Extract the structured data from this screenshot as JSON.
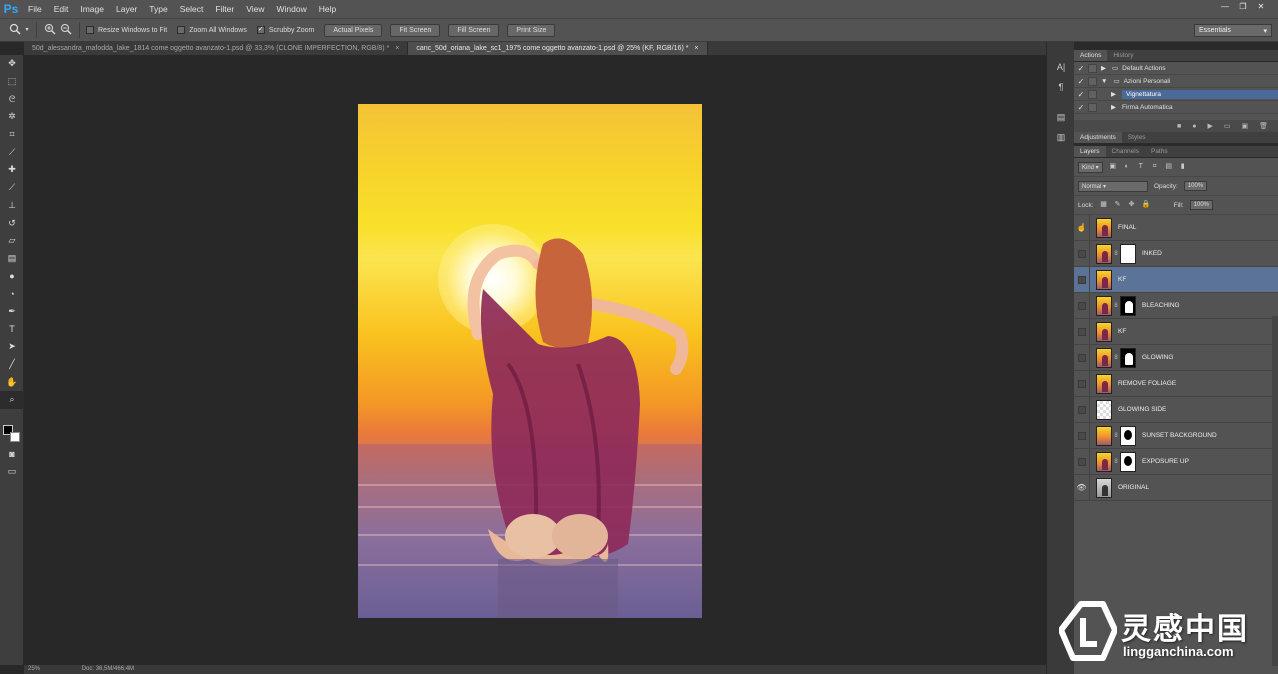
{
  "app": {
    "logo": "Ps"
  },
  "menu": [
    "File",
    "Edit",
    "Image",
    "Layer",
    "Type",
    "Select",
    "Filter",
    "View",
    "Window",
    "Help"
  ],
  "window_controls": {
    "minimize": "—",
    "restore": "❐",
    "close": "✕"
  },
  "options": {
    "tool_icon": "zoom-icon",
    "resize_windows": "Resize Windows to Fit",
    "zoom_all": "Zoom All Windows",
    "scrubby_zoom": "Scrubby Zoom",
    "scrubby_checked": "✓",
    "actual_pixels": "Actual Pixels",
    "fit_screen": "Fit Screen",
    "fill_screen": "Fill Screen",
    "print_size": "Print Size",
    "workspace": "Essentials"
  },
  "tabs": [
    {
      "label": "50d_alessandra_mafodda_lake_1814 come oggetto avanzato-1.psd @ 33,3% (CLONE IMPERFECTION, RGB/8) *",
      "close": "×"
    },
    {
      "label": "canc_50d_oriana_lake_sc1_1975 come oggetto avanzato-1.psd @ 25% (KF, RGB/16) *",
      "close": "×"
    }
  ],
  "status": {
    "zoom": "25%",
    "doc": "Doc: 36,5M/466,4M"
  },
  "actions_panel": {
    "tabs": [
      "Actions",
      "History"
    ],
    "rows": [
      {
        "check": "✓",
        "label": "Default Actions"
      },
      {
        "check": "✓",
        "label": "Azioni Personali"
      },
      {
        "check": "✓",
        "label": "Vignettatura"
      },
      {
        "check": "✓",
        "label": "Firma Automatica"
      }
    ]
  },
  "adjustments_tabs": [
    "Adjustments",
    "Styles"
  ],
  "layers_panel": {
    "tabs": [
      "Layers",
      "Channels",
      "Paths"
    ],
    "kind": "Kind",
    "blend_mode": "Normal",
    "opacity_label": "Opacity:",
    "opacity_value": "100%",
    "lock_label": "Lock:",
    "fill_label": "Fill:",
    "fill_value": "100%",
    "layers": [
      {
        "name": "FINAL"
      },
      {
        "name": "INKED"
      },
      {
        "name": "KF"
      },
      {
        "name": "BLEACHING"
      },
      {
        "name": "KF"
      },
      {
        "name": "GLOWING"
      },
      {
        "name": "REMOVE FOLIAGE"
      },
      {
        "name": "GLOWING SIDE"
      },
      {
        "name": "SUNSET BACKGROUND"
      },
      {
        "name": "EXPOSURE UP"
      },
      {
        "name": "ORIGINAL"
      }
    ]
  },
  "watermark": {
    "title": "灵感中国",
    "url": "lingganchina.com"
  }
}
